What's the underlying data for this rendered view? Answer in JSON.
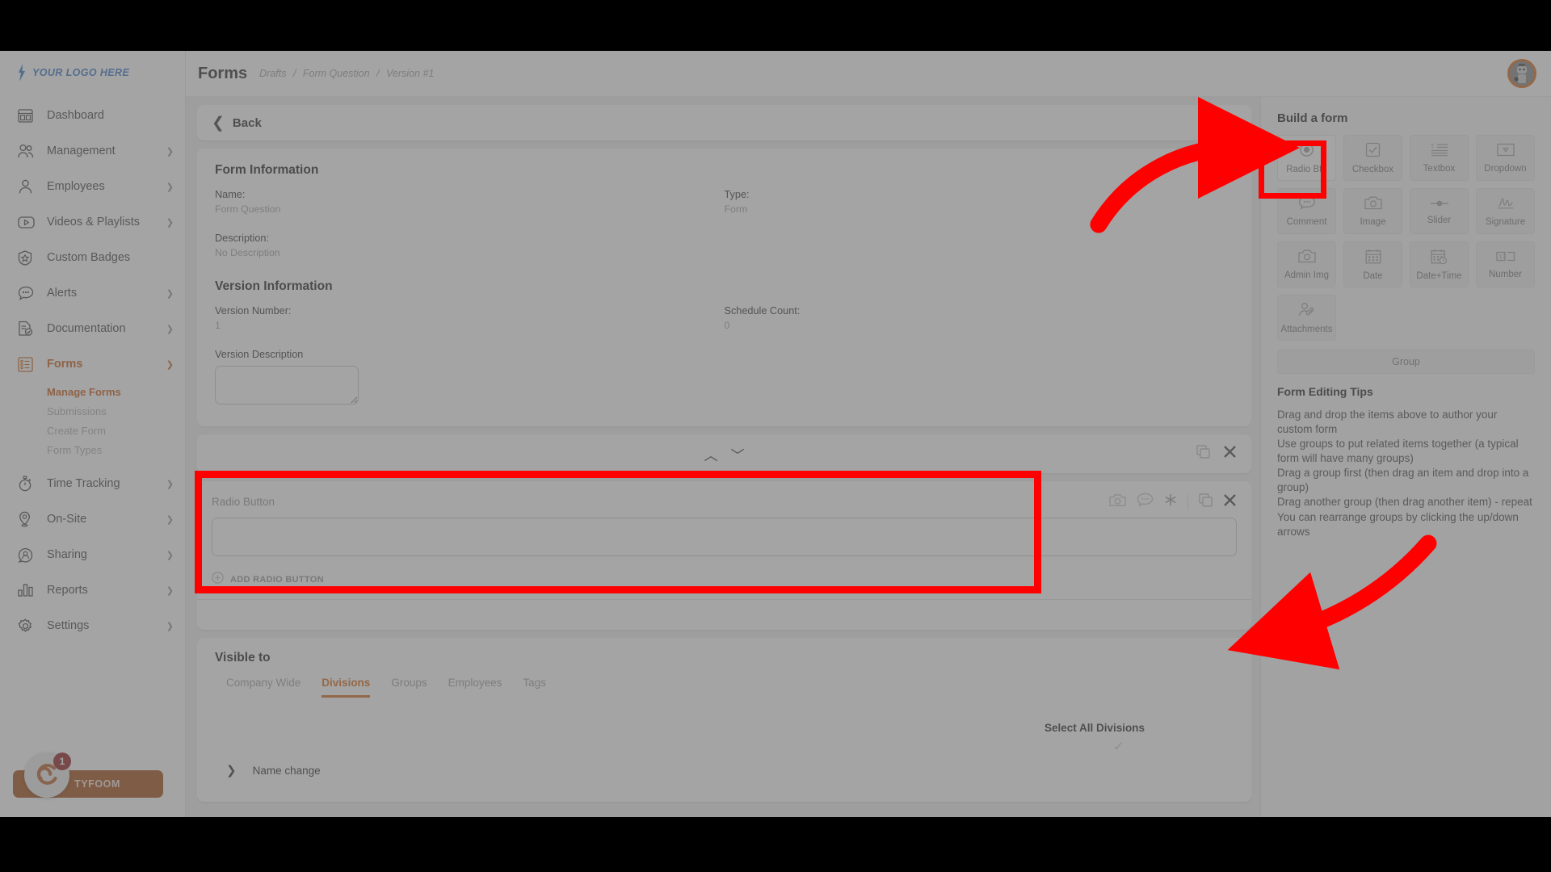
{
  "app": {
    "logo_text": "YOUR LOGO HERE",
    "brand_accent": "#d2620e",
    "logo_accent": "#2e6fc4",
    "highlight_color": "#fe0000"
  },
  "sidebar": {
    "items": [
      {
        "label": "Dashboard",
        "icon": "dashboard-icon",
        "expandable": false
      },
      {
        "label": "Management",
        "icon": "management-icon",
        "expandable": true
      },
      {
        "label": "Employees",
        "icon": "employees-icon",
        "expandable": true
      },
      {
        "label": "Videos & Playlists",
        "icon": "video-icon",
        "expandable": true
      },
      {
        "label": "Custom Badges",
        "icon": "badge-icon",
        "expandable": false
      },
      {
        "label": "Alerts",
        "icon": "alerts-icon",
        "expandable": true
      },
      {
        "label": "Documentation",
        "icon": "documentation-icon",
        "expandable": true
      },
      {
        "label": "Forms",
        "icon": "forms-icon",
        "expandable": true,
        "active": true
      },
      {
        "label": "Time Tracking",
        "icon": "stopwatch-icon",
        "expandable": true
      },
      {
        "label": "On-Site",
        "icon": "location-pin-icon",
        "expandable": true
      },
      {
        "label": "Sharing",
        "icon": "sharing-icon",
        "expandable": true
      },
      {
        "label": "Reports",
        "icon": "reports-bar-icon",
        "expandable": true
      },
      {
        "label": "Settings",
        "icon": "gear-icon",
        "expandable": true
      }
    ],
    "forms_subitems": [
      {
        "label": "Manage Forms",
        "active": true
      },
      {
        "label": "Submissions",
        "active": false
      },
      {
        "label": "Create Form",
        "active": false
      },
      {
        "label": "Form Types",
        "active": false
      }
    ],
    "footer": {
      "brand": "TYFOOM",
      "notification_count": "1"
    }
  },
  "topbar": {
    "title": "Forms",
    "breadcrumb": [
      "Drafts",
      "Form Question",
      "Version #1"
    ],
    "separator": "/"
  },
  "main": {
    "back_label": "Back",
    "form_information": {
      "section_title": "Form Information",
      "name_label": "Name:",
      "name_value": "Form Question",
      "type_label": "Type:",
      "type_value": "Form",
      "description_label": "Description:",
      "description_value": "No Description"
    },
    "version_information": {
      "section_title": "Version Information",
      "version_number_label": "Version Number:",
      "version_number_value": "1",
      "schedule_count_label": "Schedule Count:",
      "schedule_count_value": "0",
      "version_description_label": "Version Description",
      "version_description_value": ""
    },
    "mover": {
      "up_icon": "chevron-up-icon",
      "down_icon": "chevron-down-icon",
      "copy_icon": "copy-icon",
      "close_icon": "close-icon"
    },
    "radio_button_item": {
      "title": "Radio Button",
      "input_value": "",
      "add_label": "ADD RADIO BUTTON",
      "icons": [
        "camera-icon",
        "comment-icon",
        "asterisk-required-icon",
        "copy-icon",
        "close-icon"
      ]
    },
    "visible_to": {
      "section_title": "Visible to",
      "tabs": [
        {
          "label": "Company Wide",
          "active": false
        },
        {
          "label": "Divisions",
          "active": true
        },
        {
          "label": "Groups",
          "active": false
        },
        {
          "label": "Employees",
          "active": false
        },
        {
          "label": "Tags",
          "active": false
        }
      ],
      "select_all_label": "Select All Divisions",
      "divisions": [
        {
          "name": "Name change",
          "expanded": false
        }
      ]
    }
  },
  "right_panel": {
    "title": "Build a form",
    "tiles": [
      {
        "label": "Radio Btn",
        "icon": "radio-button-icon",
        "selected": true
      },
      {
        "label": "Checkbox",
        "icon": "checkbox-icon",
        "selected": false
      },
      {
        "label": "Textbox",
        "icon": "textbox-icon",
        "selected": false
      },
      {
        "label": "Dropdown",
        "icon": "dropdown-icon",
        "selected": false
      },
      {
        "label": "Comment",
        "icon": "comment-icon",
        "selected": false
      },
      {
        "label": "Image",
        "icon": "camera-icon",
        "selected": false
      },
      {
        "label": "Slider",
        "icon": "slider-icon",
        "selected": false
      },
      {
        "label": "Signature",
        "icon": "signature-icon",
        "selected": false
      },
      {
        "label": "Admin Img",
        "icon": "camera-icon",
        "selected": false
      },
      {
        "label": "Date",
        "icon": "calendar-icon",
        "selected": false
      },
      {
        "label": "Date+Time",
        "icon": "calendar-clock-icon",
        "selected": false
      },
      {
        "label": "Number",
        "icon": "number-icon",
        "selected": false
      },
      {
        "label": "Attachments",
        "icon": "attachment-icon",
        "selected": false
      }
    ],
    "group_button_label": "Group",
    "tips_title": "Form Editing Tips",
    "tips": [
      "Drag and drop the items above to author your custom form",
      "Use groups to put related items together (a typical form will have many groups)",
      "Drag a group first (then drag an item and drop into a group)",
      "Drag another group (then drag another item) - repeat",
      "You can rearrange groups by clicking the up/down arrows"
    ]
  }
}
